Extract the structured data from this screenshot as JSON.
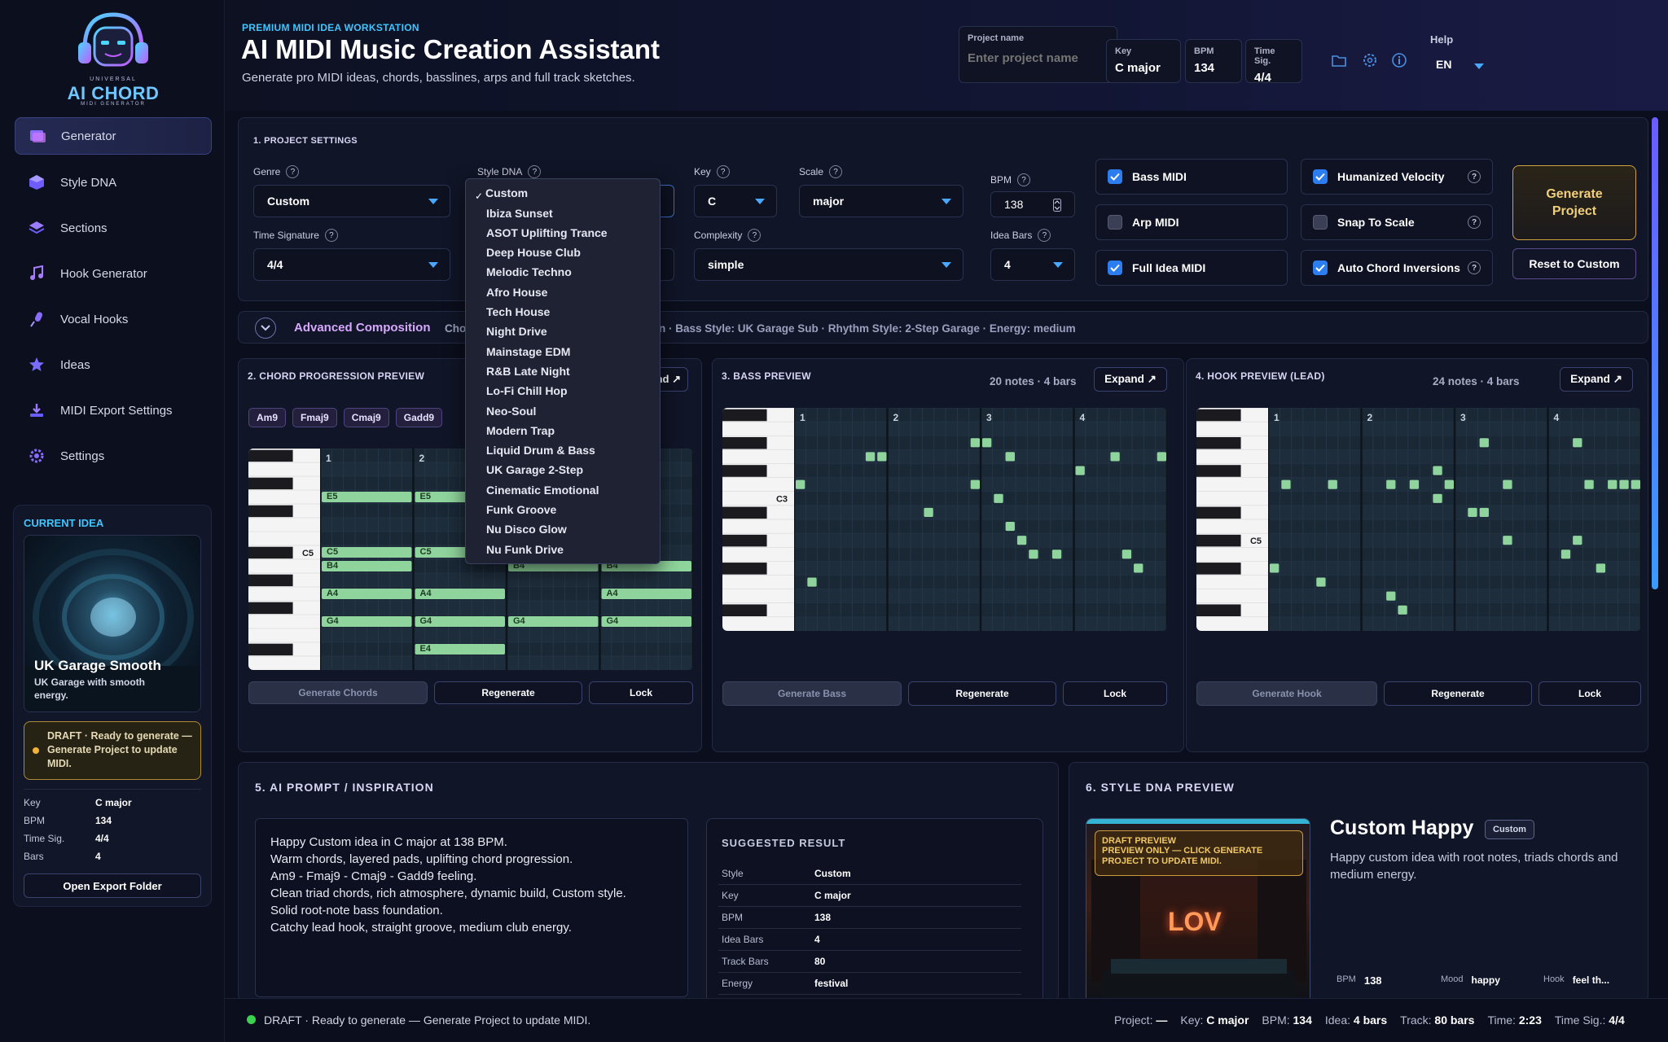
{
  "brand": {
    "line1": "UNIVERSAL",
    "line2": "AI CHORD",
    "line3": "MIDI GENERATOR"
  },
  "sidebar": {
    "items": [
      {
        "label": "Generator",
        "icon": "generator-icon"
      },
      {
        "label": "Style DNA",
        "icon": "cube-icon"
      },
      {
        "label": "Sections",
        "icon": "layers-icon"
      },
      {
        "label": "Hook Generator",
        "icon": "music-note-icon"
      },
      {
        "label": "Vocal Hooks",
        "icon": "microphone-icon"
      },
      {
        "label": "Ideas",
        "icon": "star-icon"
      },
      {
        "label": "MIDI Export Settings",
        "icon": "download-icon"
      },
      {
        "label": "Settings",
        "icon": "gear-icon"
      }
    ],
    "current_idea": {
      "heading": "CURRENT IDEA",
      "name": "UK Garage Smooth",
      "desc": "UK Garage with smooth energy.",
      "status": "DRAFT · Ready to generate — Generate Project to update MIDI.",
      "details": [
        {
          "k": "Key",
          "v": "C major"
        },
        {
          "k": "BPM",
          "v": "134"
        },
        {
          "k": "Time Sig.",
          "v": "4/4"
        },
        {
          "k": "Bars",
          "v": "4"
        }
      ],
      "open_folder": "Open Export Folder"
    }
  },
  "header": {
    "eyebrow": "PREMIUM MIDI IDEA WORKSTATION",
    "title": "AI MIDI Music Creation Assistant",
    "subtitle": "Generate pro MIDI ideas, chords, basslines, arps and full track sketches.",
    "project_name_label": "Project name",
    "project_name_placeholder": "Enter project name",
    "key_label": "Key",
    "key_value": "C major",
    "bpm_label": "BPM",
    "bpm_value": "134",
    "timesig_label": "Time Sig.",
    "timesig_value": "4/4",
    "help_label": "Help",
    "lang": "EN"
  },
  "settings": {
    "title": "1. PROJECT SETTINGS",
    "genre_label": "Genre",
    "genre_value": "Custom",
    "style_label": "Style DNA",
    "key_label": "Key",
    "key_value": "C",
    "scale_label": "Scale",
    "scale_value": "major",
    "bpm_label": "BPM",
    "bpm_value": "138",
    "timesig_label": "Time Signature",
    "timesig_value": "4/4",
    "complexity_label": "Complexity",
    "complexity_value": "simple",
    "ideabars_label": "Idea Bars",
    "ideabars_value": "4",
    "checkboxes": [
      {
        "label": "Bass MIDI",
        "checked": true
      },
      {
        "label": "Arp MIDI",
        "checked": false
      },
      {
        "label": "Full Idea MIDI",
        "checked": true
      },
      {
        "label": "Humanized Velocity",
        "checked": true
      },
      {
        "label": "Snap To Scale",
        "checked": false
      },
      {
        "label": "Auto Chord Inversions",
        "checked": true
      }
    ],
    "generate_button": "Generate\nProject",
    "reset_button": "Reset to Custom"
  },
  "style_dropdown": {
    "selected": "Custom",
    "options": [
      "Custom",
      "Ibiza Sunset",
      "ASOT Uplifting Trance",
      "Deep House Club",
      "Melodic Techno",
      "Afro House",
      "Tech House",
      "Night Drive",
      "Mainstage EDM",
      "R&B Late Night",
      "Lo-Fi Chill Hop",
      "Neo-Soul",
      "Modern Trap",
      "Liquid Drum & Bass",
      "UK Garage 2-Step",
      "Cinematic Emotional",
      "Funk Groove",
      "Nu Disco Glow",
      "Nu Funk Drive"
    ]
  },
  "advanced": {
    "label": "Advanced Composition",
    "text_left": "Cho",
    "text_right": "n · Bass Style: UK Garage Sub · Rhythm Style: 2-Step Garage · Energy: medium"
  },
  "chord_panel": {
    "title": "2. CHORD PROGRESSION PREVIEW",
    "expand_partial": "nd ↗",
    "chips": [
      "Am9",
      "Fmaj9",
      "Cmaj9",
      "Gadd9"
    ],
    "bars": [
      "1",
      "2"
    ],
    "octave_label": "C5",
    "notes": [
      {
        "label": "E5",
        "bar": 0,
        "len": 1,
        "row": 3
      },
      {
        "label": "E5",
        "bar": 1,
        "len": 1,
        "row": 3
      },
      {
        "label": "C5",
        "bar": 0,
        "len": 1,
        "row": 7
      },
      {
        "label": "C5",
        "bar": 1,
        "len": 1,
        "row": 7
      },
      {
        "label": "C5",
        "bar": 2,
        "len": 1,
        "row": 7
      },
      {
        "label": "B4",
        "bar": 0,
        "len": 1,
        "row": 8
      },
      {
        "label": "B4",
        "bar": 2,
        "len": 1,
        "row": 8
      },
      {
        "label": "B4",
        "bar": 3,
        "len": 1,
        "row": 8
      },
      {
        "label": "A4",
        "bar": 0,
        "len": 1,
        "row": 10
      },
      {
        "label": "A4",
        "bar": 1,
        "len": 1,
        "row": 10
      },
      {
        "label": "A4",
        "bar": 3,
        "len": 1,
        "row": 10
      },
      {
        "label": "G4",
        "bar": 0,
        "len": 1,
        "row": 12
      },
      {
        "label": "G4",
        "bar": 1,
        "len": 1,
        "row": 12
      },
      {
        "label": "G4",
        "bar": 2,
        "len": 1,
        "row": 12
      },
      {
        "label": "G4",
        "bar": 3,
        "len": 1,
        "row": 12
      },
      {
        "label": "E4",
        "bar": 1,
        "len": 1,
        "row": 14
      }
    ],
    "buttons": [
      "Generate Chords",
      "Regenerate",
      "Lock"
    ]
  },
  "bass_panel": {
    "title": "3. BASS PREVIEW",
    "count": "20 notes · 4 bars",
    "expand": "Expand ↗",
    "bars": [
      "1",
      "2",
      "3",
      "4"
    ],
    "octave_label": "C3",
    "notes": [
      [
        3,
        7
      ],
      [
        2,
        12
      ],
      [
        3,
        12
      ],
      [
        3,
        29
      ],
      [
        4,
        12
      ],
      [
        3,
        35
      ],
      [
        3,
        41
      ],
      [
        5,
        11
      ],
      [
        2,
        24
      ],
      [
        3,
        36
      ],
      [
        5,
        17
      ],
      [
        6,
        16
      ],
      [
        7,
        7
      ],
      [
        8,
        11
      ],
      [
        9,
        9
      ],
      [
        10,
        15
      ],
      [
        10,
        6
      ],
      [
        10,
        1
      ],
      [
        11,
        7
      ],
      [
        12,
        8
      ]
    ],
    "buttons": [
      "Generate Bass",
      "Regenerate",
      "Lock"
    ]
  },
  "hook_panel": {
    "title": "4. HOOK PREVIEW (LEAD)",
    "count": "24 notes · 4 bars",
    "expand": "Expand ↗",
    "bars": [
      "1",
      "2",
      "3",
      "4"
    ],
    "octave_label": "C5",
    "notes": [
      [
        5,
        10
      ],
      [
        2,
        15
      ],
      [
        4,
        8
      ],
      [
        5,
        6
      ],
      [
        5,
        8
      ],
      [
        5,
        14
      ],
      [
        5,
        12
      ],
      [
        5,
        6
      ],
      [
        2,
        2
      ],
      [
        5,
        4
      ],
      [
        5,
        3
      ],
      [
        5,
        4
      ],
      [
        5,
        8
      ],
      [
        6,
        7
      ],
      [
        7,
        7
      ],
      [
        7,
        5
      ],
      [
        9,
        4
      ],
      [
        9,
        7
      ],
      [
        10,
        3
      ],
      [
        11,
        3
      ],
      [
        11,
        4
      ],
      [
        12,
        5
      ],
      [
        13,
        8
      ],
      [
        14,
        6
      ]
    ],
    "buttons": [
      "Generate Hook",
      "Regenerate",
      "Lock"
    ]
  },
  "prompt_panel": {
    "title": "5. AI PROMPT / INSPIRATION",
    "lines": [
      "Happy Custom idea in C major at 138 BPM.",
      "Warm chords, layered pads, uplifting chord progression.",
      "Am9 - Fmaj9 - Cmaj9 - Gadd9 feeling.",
      "Clean triad chords, rich atmosphere, dynamic build, Custom style.",
      "Solid root-note bass foundation.",
      "Catchy lead hook, straight groove, medium club energy."
    ],
    "suggested_title": "SUGGESTED RESULT",
    "suggested": [
      {
        "k": "Style",
        "v": "Custom"
      },
      {
        "k": "Key",
        "v": "C major"
      },
      {
        "k": "BPM",
        "v": "138"
      },
      {
        "k": "Idea Bars",
        "v": "4"
      },
      {
        "k": "Track Bars",
        "v": "80"
      },
      {
        "k": "Energy",
        "v": "festival"
      }
    ]
  },
  "dna_panel": {
    "title": "6. STYLE DNA PREVIEW",
    "name": "Custom Happy",
    "badge": "Custom",
    "desc": "Happy custom idea with root notes, triads chords and medium energy.",
    "overlay_title": "DRAFT PREVIEW",
    "overlay_text": "PREVIEW ONLY — CLICK GENERATE PROJECT TO UPDATE MIDI.",
    "neon": "LOV",
    "stats": [
      {
        "k": "BPM",
        "v": "138"
      },
      {
        "k": "Mood",
        "v": "happy"
      },
      {
        "k": "Hook",
        "v": "feel th..."
      }
    ]
  },
  "status_bar": {
    "text": "DRAFT · Ready to generate — Generate Project to update MIDI.",
    "items": [
      {
        "k": "Project:",
        "v": "—"
      },
      {
        "k": "Key:",
        "v": "C major"
      },
      {
        "k": "BPM:",
        "v": "134"
      },
      {
        "k": "Idea:",
        "v": "4 bars"
      },
      {
        "k": "Track:",
        "v": "80 bars"
      },
      {
        "k": "Time:",
        "v": "2:23"
      },
      {
        "k": "Time Sig.:",
        "v": "4/4"
      }
    ]
  },
  "colors": {
    "accent": "#4aa8ff",
    "note": "#8fd89a",
    "gold": "#e0b34a",
    "status_dot": "#3ad24e"
  }
}
